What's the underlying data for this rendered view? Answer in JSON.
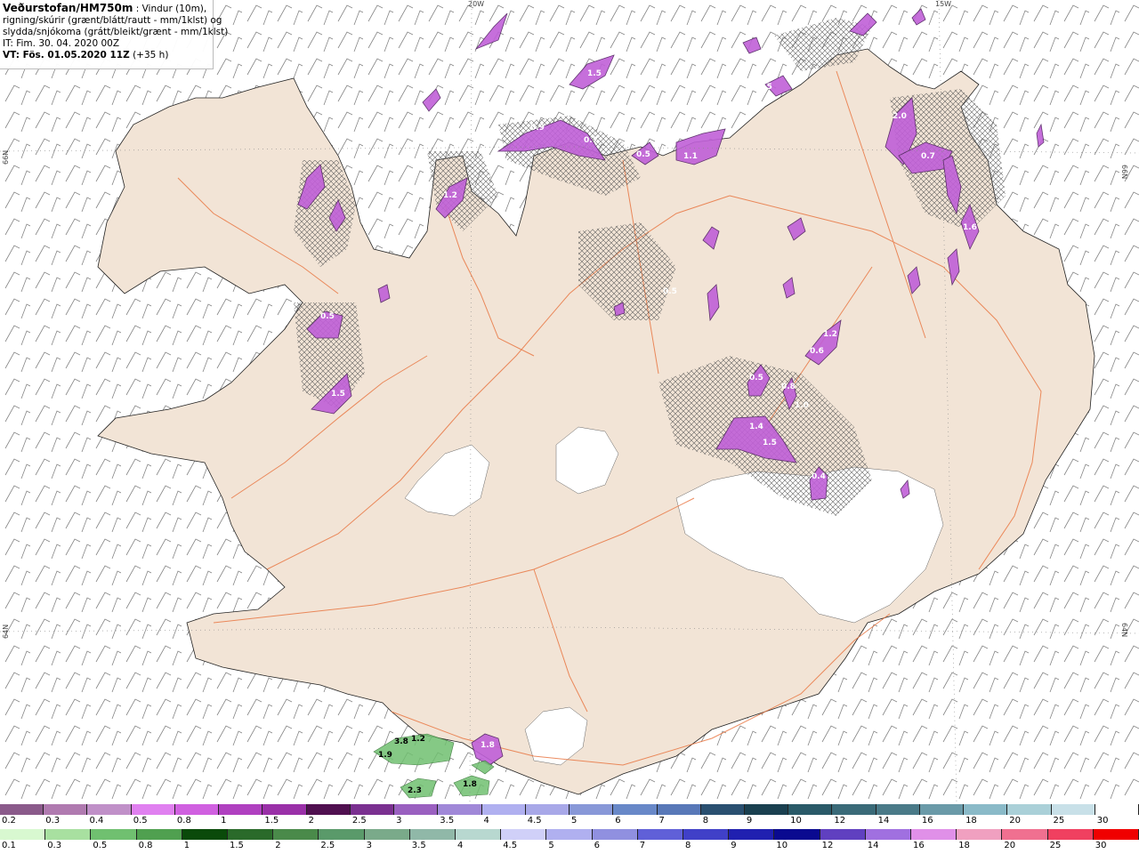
{
  "header": {
    "source_title": "Veðurstofan/HM750m",
    "desc_line1": ": Vindur (10m),",
    "desc_line2": "rigning/skúrir (grænt/blátt/rautt - mm/1klst) og",
    "desc_line3": "slydda/snjókoma (grátt/bleikt/grænt - mm/1klst)",
    "issue_time": "IT: Fim. 30. 04. 2020 00Z",
    "valid_time_label": "VT: Fös. 01.05.2020 11Z",
    "lead_time": "(+35 h)"
  },
  "grid_labels": {
    "lon_20w": "20W",
    "lon_15w": "15W",
    "lat_66n_left": "66N",
    "lat_66n_right": "66N",
    "lat_64n_left": "64N",
    "lat_64n_right": "64N"
  },
  "precip_labels": [
    "0.9",
    "0.7",
    "1.5",
    "1.2",
    "0.5",
    "1.5",
    "1.0",
    "0.5",
    "0.8",
    "1.4",
    "1.5",
    "0.4",
    "2.0",
    "0.7",
    "1.6",
    "0.5",
    "1.2",
    "0.6",
    "0.5",
    "1.1",
    "0.5",
    "1.8",
    "3.8",
    "1.2",
    "1.9",
    "2.3",
    "1.8"
  ],
  "snow_scale": {
    "labels": [
      "0.2",
      "0.3",
      "0.4",
      "0.5",
      "0.8",
      "1",
      "1.5",
      "2",
      "2.5",
      "3",
      "3.5",
      "4",
      "4.5",
      "5",
      "6",
      "7",
      "8",
      "9",
      "10",
      "12",
      "14",
      "16",
      "18",
      "20",
      "25",
      "30"
    ],
    "colors": [
      "#8a5a8a",
      "#b07ab0",
      "#c090c8",
      "#e080f0",
      "#d060e0",
      "#b040c0",
      "#9a30a8",
      "#501050",
      "#7a3090",
      "#9a60c0",
      "#a088d8",
      "#b0b0f0",
      "#a8a8e8",
      "#8898d8",
      "#6888c8",
      "#5878b8",
      "#2a5070",
      "#1a4050",
      "#2a5a68",
      "#3a6a78",
      "#4a7a88",
      "#6a9aa8",
      "#8abac8",
      "#aad0d8",
      "#c8e0e8",
      "#ffffff"
    ]
  },
  "rain_scale": {
    "labels": [
      "0.1",
      "0.3",
      "0.5",
      "0.8",
      "1",
      "1.5",
      "2",
      "2.5",
      "3",
      "3.5",
      "4",
      "4.5",
      "5",
      "6",
      "7",
      "8",
      "9",
      "10",
      "12",
      "14",
      "16",
      "18",
      "20",
      "25",
      "30"
    ],
    "colors": [
      "#d8f8d0",
      "#a8e0a0",
      "#70c070",
      "#50a050",
      "#0a4a0a",
      "#2a6a2a",
      "#4a8a4a",
      "#5a9a6a",
      "#7aaa8a",
      "#90b8a8",
      "#b8d8d0",
      "#d0d0f8",
      "#b0b0f0",
      "#9090e0",
      "#6060d8",
      "#4040c8",
      "#2020b0",
      "#0a0a90",
      "#6040c0",
      "#a070e0",
      "#e090e8",
      "#f0a0c0",
      "#f07090",
      "#f04060",
      "#f00000"
    ]
  }
}
